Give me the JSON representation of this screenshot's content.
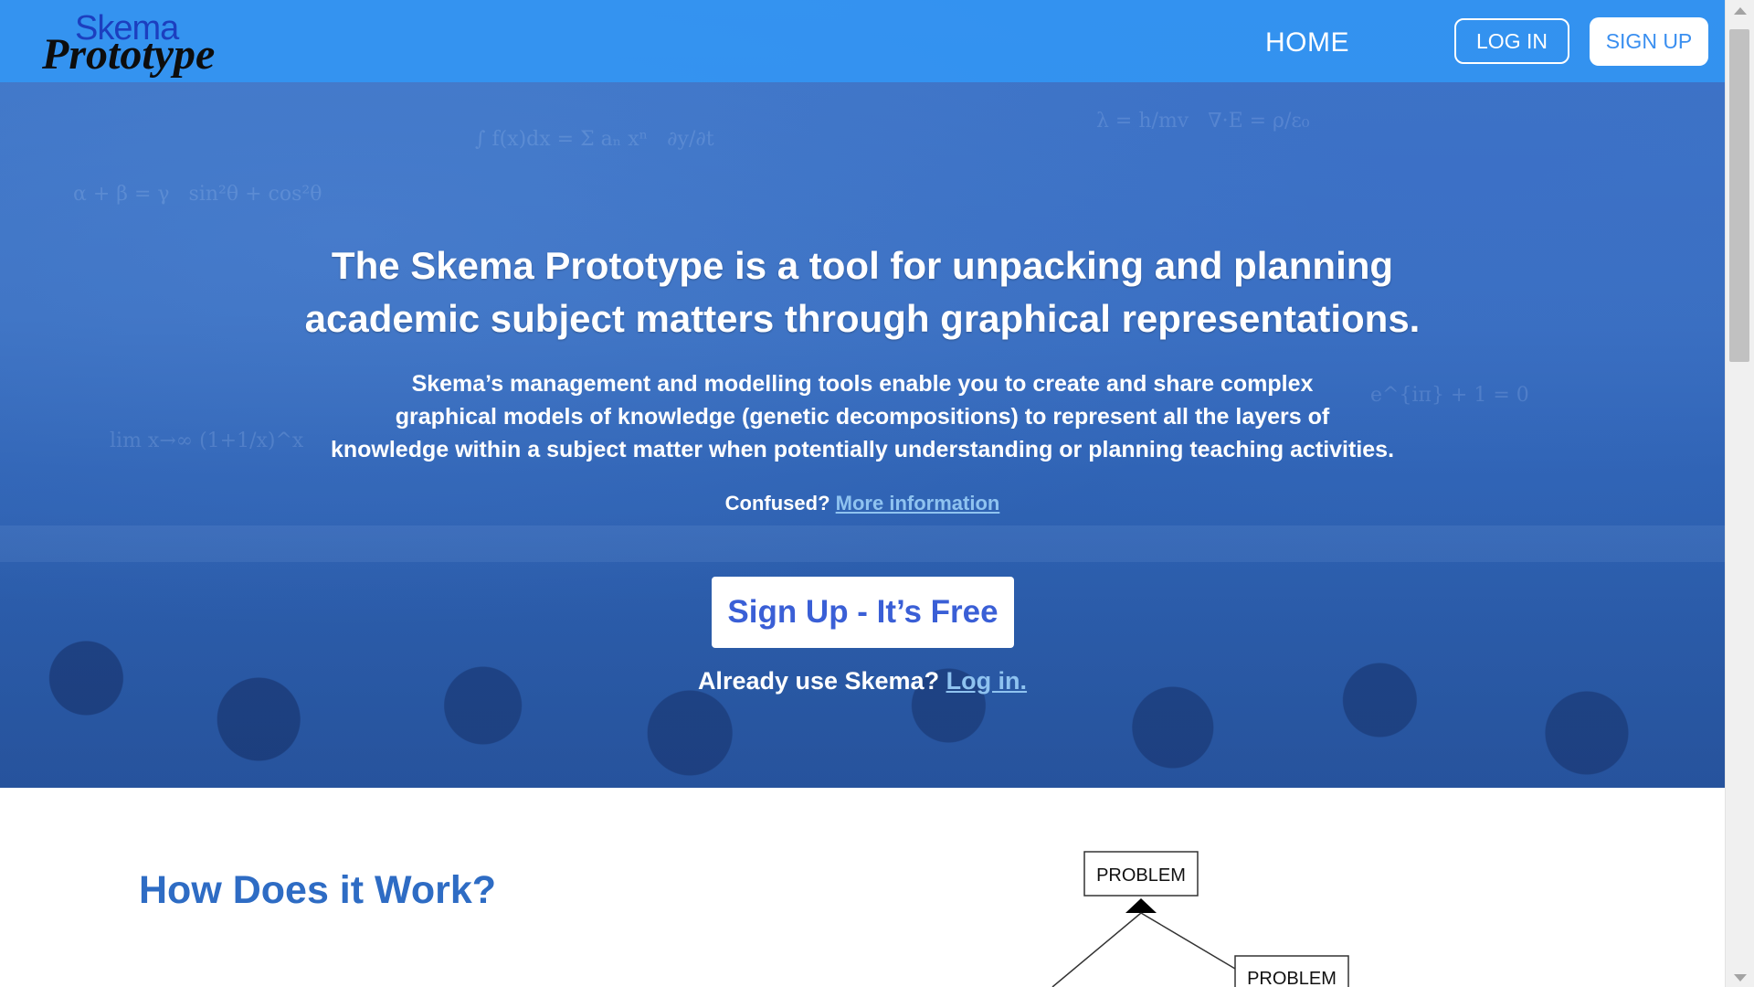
{
  "header": {
    "logo_top": "Skema",
    "logo_bottom": "Prototype",
    "nav_home": "HOME",
    "login_label": "LOG IN",
    "signup_label": "SIGN UP"
  },
  "hero": {
    "headline_line1": "The Skema Prototype is a tool for unpacking and planning",
    "headline_line2": "academic subject matters through graphical representations.",
    "sub_line1": "Skema’s management and modelling tools enable you to create and share complex",
    "sub_line2": "graphical models of knowledge (genetic decompositions) to represent all the layers of",
    "sub_line3": "knowledge within a subject matter when potentially understanding or planning teaching activities.",
    "confused_text": "Confused? ",
    "more_info_link": "More information",
    "cta_label": "Sign Up - It’s Free",
    "already_text": "Already use Skema? ",
    "login_link": "Log in."
  },
  "section": {
    "how_title": "How Does it Work?",
    "diagram_node1": "PROBLEM",
    "diagram_node2": "PROBLEM"
  },
  "colors": {
    "header_bg": "#3296f5",
    "accent_blue": "#3a5fd6",
    "title_blue": "#2e6cc4"
  }
}
